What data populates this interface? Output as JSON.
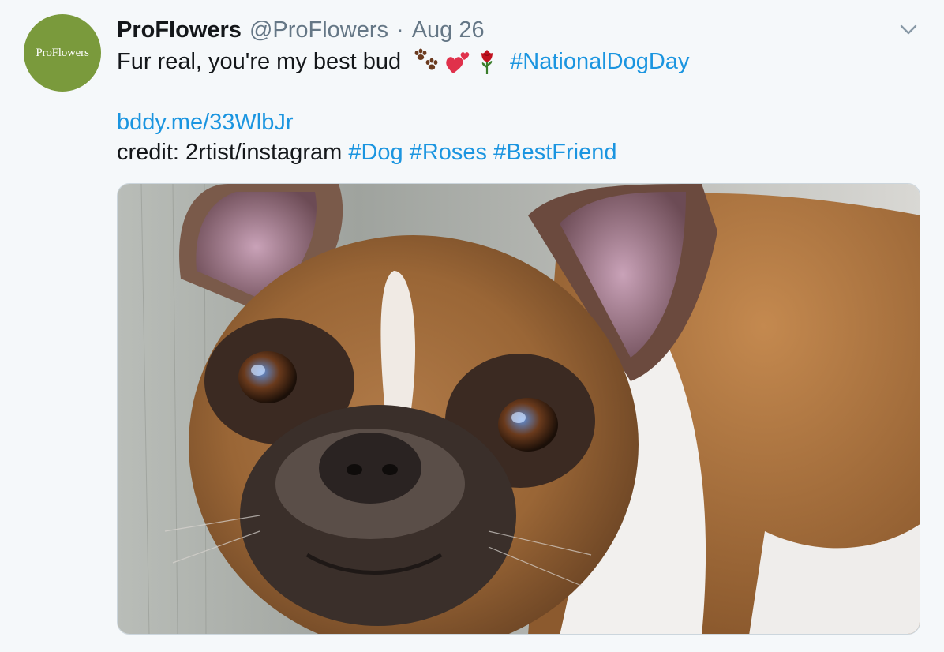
{
  "tweet": {
    "avatar_text": "ProFlowers",
    "display_name": "ProFlowers",
    "handle": "@ProFlowers",
    "separator": "·",
    "date": "Aug 26",
    "text_line1": "Fur real, you're my best bud",
    "emojis": [
      "paw-prints-icon",
      "two-hearts-icon",
      "rose-icon"
    ],
    "hashtag_national": "#NationalDogDay",
    "link": "bddy.me/33WlbJr",
    "credit_prefix": "credit: 2rtist/instagram",
    "hashtags": [
      "#Dog",
      "#Roses",
      "#BestFriend"
    ],
    "media_alt": "French bulldog looking up at the camera"
  },
  "colors": {
    "background": "#f5f8fa",
    "link": "#1b95e0",
    "secondary_text": "#657786",
    "avatar_green": "#7a9a3c"
  }
}
